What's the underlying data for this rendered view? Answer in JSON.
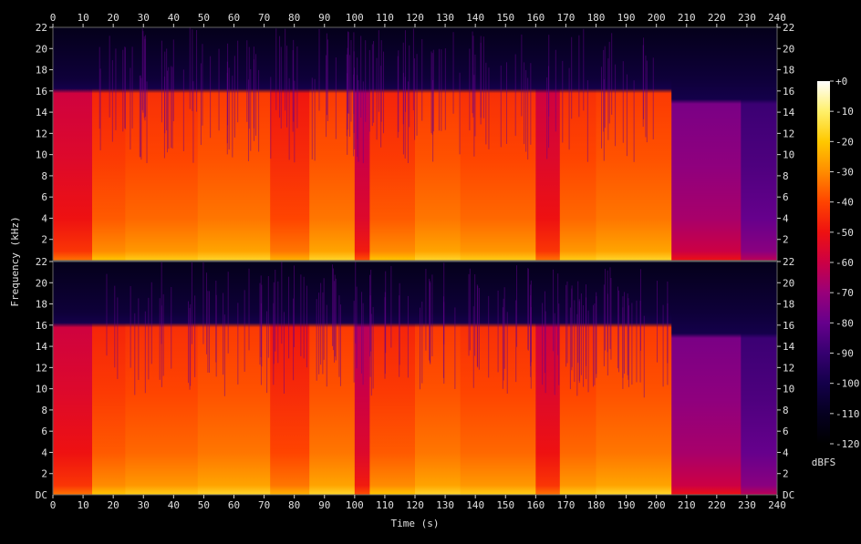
{
  "chart_data": {
    "type": "heatmap",
    "xlabel": "Time (s)",
    "ylabel": "Frequency (kHz)",
    "xlim": [
      0,
      240
    ],
    "ylim": [
      0,
      22
    ],
    "x_ticks": [
      "0",
      "10",
      "20",
      "30",
      "40",
      "50",
      "60",
      "70",
      "80",
      "90",
      "100",
      "110",
      "120",
      "130",
      "140",
      "150",
      "160",
      "170",
      "180",
      "190",
      "200",
      "210",
      "220",
      "230",
      "240"
    ],
    "y_ticks": [
      "2",
      "4",
      "6",
      "8",
      "10",
      "12",
      "14",
      "16",
      "18",
      "20",
      "22"
    ],
    "dc_label": "DC",
    "channels": 2,
    "colorbar": {
      "label": "dBFS",
      "ticks": [
        "+0",
        "-10",
        "-20",
        "-30",
        "-40",
        "-50",
        "-60",
        "-70",
        "-80",
        "-90",
        "-100",
        "-110",
        "-120"
      ],
      "range": [
        -120,
        0
      ],
      "stops": [
        "#ffffff",
        "#fff06a",
        "#ffc800",
        "#ff8c00",
        "#ff4400",
        "#ee1111",
        "#cc0044",
        "#99007a",
        "#66008c",
        "#360070",
        "#14004a",
        "#050020",
        "#000000"
      ]
    },
    "segments": [
      {
        "t0": 0,
        "t1": 13,
        "level": -55,
        "cutoff_khz": 16
      },
      {
        "t0": 13,
        "t1": 24,
        "level": -42,
        "cutoff_khz": 16
      },
      {
        "t0": 24,
        "t1": 48,
        "level": -40,
        "cutoff_khz": 16
      },
      {
        "t0": 48,
        "t1": 72,
        "level": -38,
        "cutoff_khz": 16
      },
      {
        "t0": 72,
        "t1": 85,
        "level": -45,
        "cutoff_khz": 16
      },
      {
        "t0": 85,
        "t1": 100,
        "level": -38,
        "cutoff_khz": 16
      },
      {
        "t0": 100,
        "t1": 105,
        "level": -60,
        "cutoff_khz": 16
      },
      {
        "t0": 105,
        "t1": 120,
        "level": -42,
        "cutoff_khz": 16
      },
      {
        "t0": 120,
        "t1": 135,
        "level": -38,
        "cutoff_khz": 16
      },
      {
        "t0": 135,
        "t1": 160,
        "level": -40,
        "cutoff_khz": 16
      },
      {
        "t0": 160,
        "t1": 168,
        "level": -55,
        "cutoff_khz": 16
      },
      {
        "t0": 168,
        "t1": 180,
        "level": -40,
        "cutoff_khz": 16
      },
      {
        "t0": 180,
        "t1": 205,
        "level": -38,
        "cutoff_khz": 16
      },
      {
        "t0": 205,
        "t1": 228,
        "level": -72,
        "cutoff_khz": 15
      },
      {
        "t0": 228,
        "t1": 240,
        "level": -85,
        "cutoff_khz": 15
      }
    ]
  }
}
